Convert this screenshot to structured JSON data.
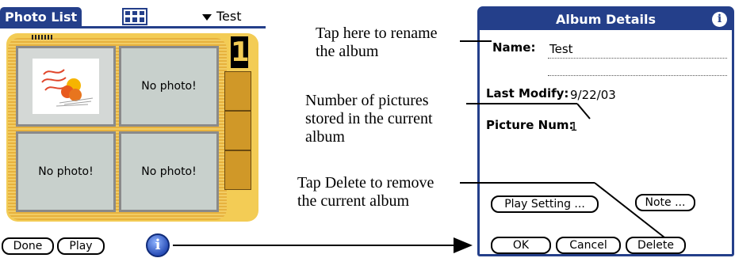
{
  "photo_list": {
    "title": "Photo List",
    "album_selector": "Test",
    "page_number": "1",
    "photos": [
      {
        "label": ""
      },
      {
        "label": "No photo!"
      },
      {
        "label": "No photo!"
      },
      {
        "label": "No photo!"
      }
    ],
    "buttons": {
      "done": "Done",
      "play": "Play"
    },
    "icons": {
      "view_toggle": "grid-view-icon",
      "details": "info-icon"
    }
  },
  "callouts": {
    "rename": [
      "Tap here to rename",
      "the album"
    ],
    "count": [
      "Number of pictures",
      "stored in the current",
      "album"
    ],
    "delete": [
      "Tap Delete to remove",
      "the current album"
    ]
  },
  "album_details": {
    "title": "Album Details",
    "name_label": "Name:",
    "name_value": "Test",
    "last_modify_label": "Last Modify:",
    "last_modify_value": "9/22/03",
    "picture_num_label": "Picture Num:",
    "picture_num_value": "1",
    "buttons": {
      "play_setting": "Play Setting ...",
      "note": "Note ...",
      "ok": "OK",
      "cancel": "Cancel",
      "delete": "Delete"
    }
  },
  "colors": {
    "palm_blue": "#243f8a",
    "album_gold": "#e9b948",
    "photo_gray": "#c8d0cc"
  }
}
